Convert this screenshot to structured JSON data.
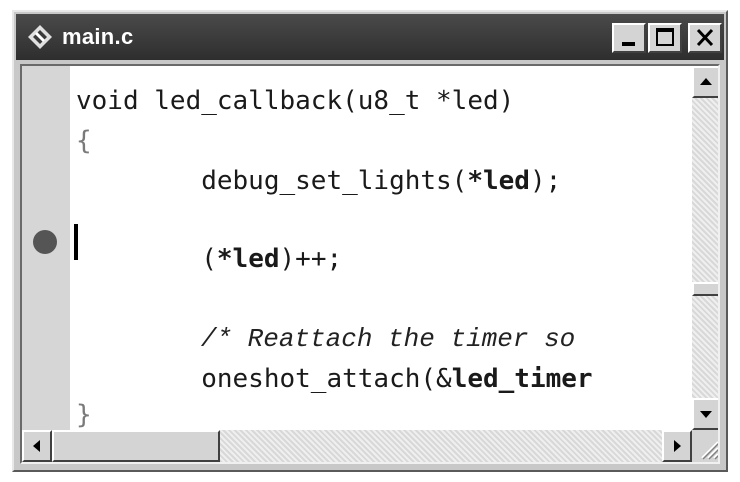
{
  "window": {
    "title": "main.c",
    "icon": "app-logo-icon",
    "controls": {
      "minimize": "minimize-icon",
      "maximize": "maximize-icon",
      "close": "close-icon"
    }
  },
  "editor": {
    "lines": [
      "void led_callback(u8_t *led)",
      "{",
      "        debug_set_lights(*led);",
      "",
      "        (*led)++;",
      "",
      "        /* Reattach the timer so",
      "        oneshot_attach(&led_timer",
      "}"
    ],
    "breakpoint_line": 5,
    "cursor_line": 5,
    "vertical_scroll_position": 0.62,
    "horizontal_scroll_position": 0.0
  }
}
